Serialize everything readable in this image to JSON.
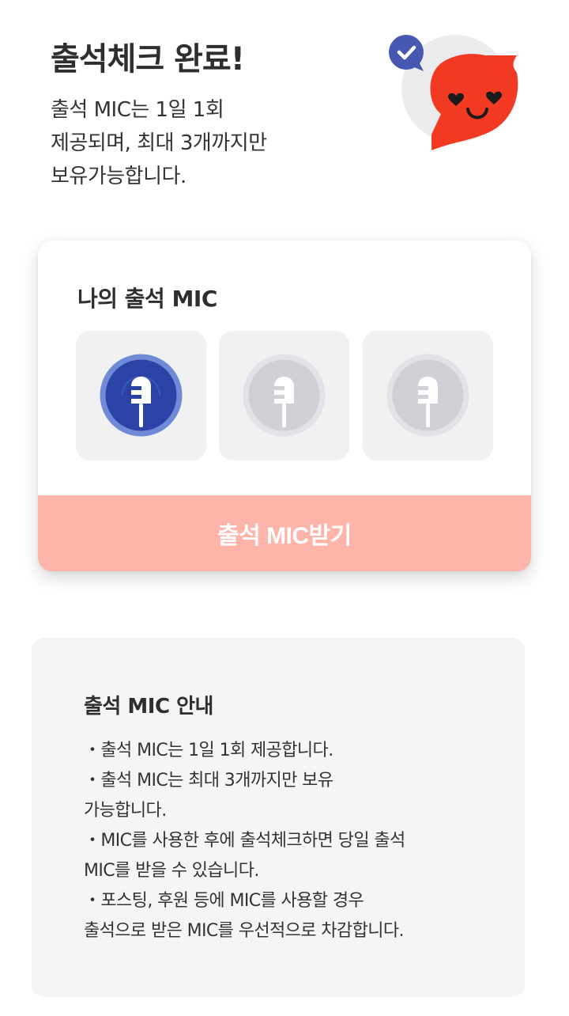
{
  "header": {
    "title": "출석체크 완료!",
    "description": "출석 MIC는 1일 1회\n제공되며, 최대 3개까지만\n보유가능합니다."
  },
  "card": {
    "title": "나의 출석 MIC",
    "mic_slots": [
      {
        "state": "active",
        "icon": "mic-coin-icon"
      },
      {
        "state": "inactive",
        "icon": "mic-coin-icon"
      },
      {
        "state": "inactive",
        "icon": "mic-coin-icon"
      }
    ],
    "button_label": "출석 MIC받기"
  },
  "info": {
    "title": "출석 MIC 안내",
    "items": [
      "・출석 MIC는 1일 1회 제공합니다.",
      "・출석 MIC는 최대 3개까지만 보유\n가능합니다.",
      "・MIC를 사용한 후에 출석체크하면 당일 출석\nMIC를 받을 수 있습니다.",
      "・포스팅, 후원 등에 MIC를 사용할 경우\n출석으로 받은 MIC를 우선적으로 차감합니다."
    ]
  },
  "colors": {
    "button_bg": "#ffb4aa",
    "mascot_red": "#f23a22",
    "check_badge": "#4758b3",
    "mic_active": "#2f47a8",
    "mic_inactive": "#d4d5da"
  }
}
